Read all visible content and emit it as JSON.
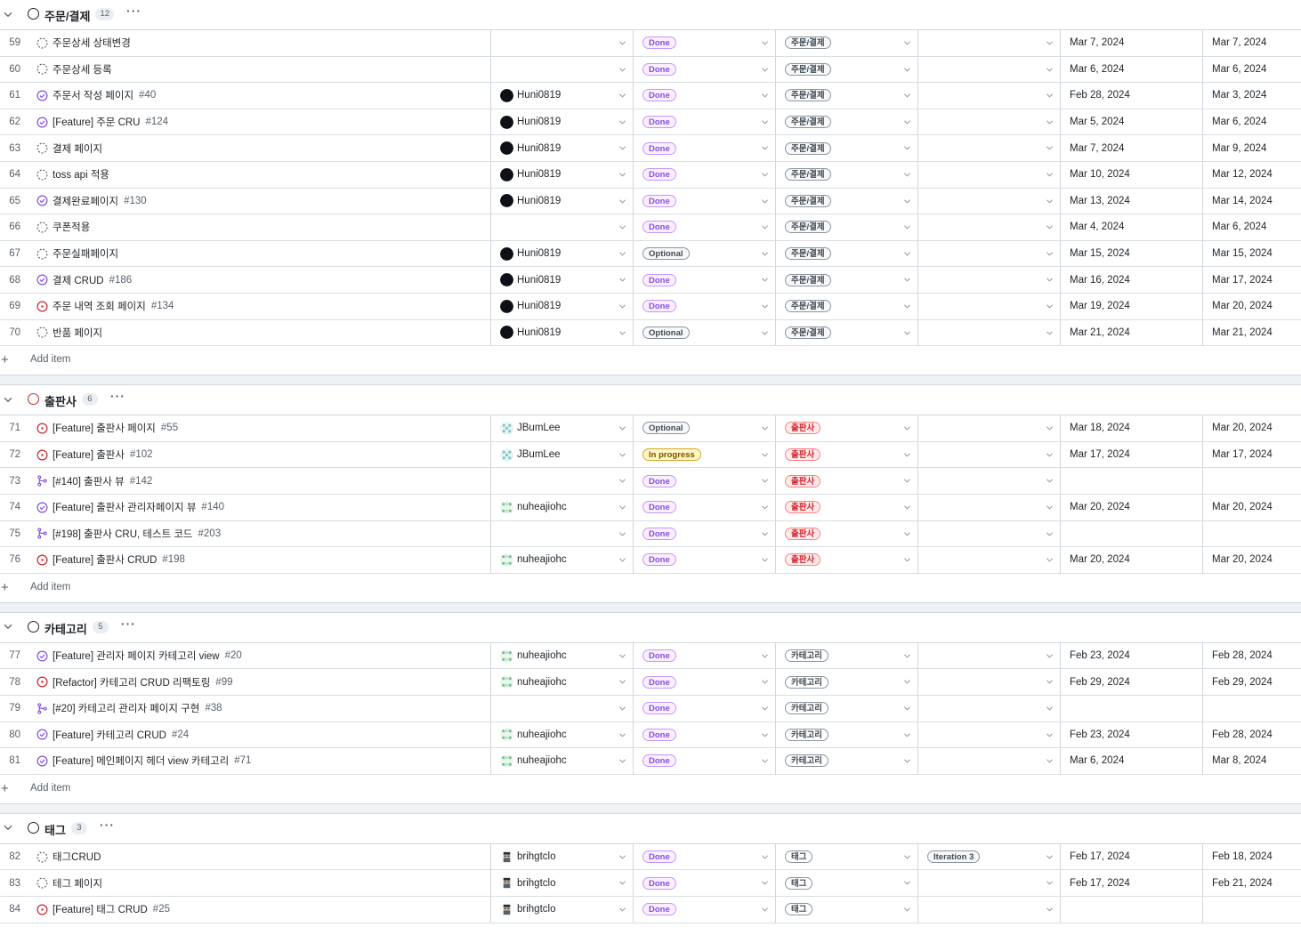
{
  "groups": [
    {
      "title": "주문/결제",
      "count": "12",
      "circle_color": "#1f2328",
      "rows": [
        {
          "num": "59",
          "icon": "draft-issue",
          "title": "주문상세 상태변경",
          "ref": "",
          "assignee": "",
          "avatar": "",
          "status": "Done",
          "label": "주문/결제",
          "iteration": "",
          "start": "Mar 7, 2024",
          "end": "Mar 7, 2024"
        },
        {
          "num": "60",
          "icon": "draft-issue",
          "title": "주문상세 등록",
          "ref": "",
          "assignee": "",
          "avatar": "",
          "status": "Done",
          "label": "주문/결제",
          "iteration": "",
          "start": "Mar 6, 2024",
          "end": "Mar 6, 2024"
        },
        {
          "num": "61",
          "icon": "closed-issue",
          "title": "주문서 작성 페이지",
          "ref": "#40",
          "assignee": "Huni0819",
          "avatar": "black",
          "status": "Done",
          "label": "주문/결제",
          "iteration": "",
          "start": "Feb 28, 2024",
          "end": "Mar 3, 2024"
        },
        {
          "num": "62",
          "icon": "closed-issue",
          "title": "[Feature] 주문 CRU",
          "ref": "#124",
          "assignee": "Huni0819",
          "avatar": "black",
          "status": "Done",
          "label": "주문/결제",
          "iteration": "",
          "start": "Mar 5, 2024",
          "end": "Mar 6, 2024"
        },
        {
          "num": "63",
          "icon": "draft-issue",
          "title": "결제 페이지",
          "ref": "",
          "assignee": "Huni0819",
          "avatar": "black",
          "status": "Done",
          "label": "주문/결제",
          "iteration": "",
          "start": "Mar 7, 2024",
          "end": "Mar 9, 2024"
        },
        {
          "num": "64",
          "icon": "draft-issue",
          "title": "toss api 적용",
          "ref": "",
          "assignee": "Huni0819",
          "avatar": "black",
          "status": "Done",
          "label": "주문/결제",
          "iteration": "",
          "start": "Mar 10, 2024",
          "end": "Mar 12, 2024"
        },
        {
          "num": "65",
          "icon": "closed-issue",
          "title": "결제완료페이지",
          "ref": "#130",
          "assignee": "Huni0819",
          "avatar": "black",
          "status": "Done",
          "label": "주문/결제",
          "iteration": "",
          "start": "Mar 13, 2024",
          "end": "Mar 14, 2024"
        },
        {
          "num": "66",
          "icon": "draft-issue",
          "title": "쿠폰적용",
          "ref": "",
          "assignee": "",
          "avatar": "",
          "status": "Done",
          "label": "주문/결제",
          "iteration": "",
          "start": "Mar 4, 2024",
          "end": "Mar 6, 2024"
        },
        {
          "num": "67",
          "icon": "draft-issue",
          "title": "주문실패페이지",
          "ref": "",
          "assignee": "Huni0819",
          "avatar": "black",
          "status": "Optional",
          "label": "주문/결제",
          "iteration": "",
          "start": "Mar 15, 2024",
          "end": "Mar 15, 2024"
        },
        {
          "num": "68",
          "icon": "closed-issue",
          "title": "결제 CRUD",
          "ref": "#186",
          "assignee": "Huni0819",
          "avatar": "black",
          "status": "Done",
          "label": "주문/결제",
          "iteration": "",
          "start": "Mar 16, 2024",
          "end": "Mar 17, 2024"
        },
        {
          "num": "69",
          "icon": "open-issue",
          "title": "주문 내역 조회 페이지",
          "ref": "#134",
          "assignee": "Huni0819",
          "avatar": "black",
          "status": "Done",
          "label": "주문/결제",
          "iteration": "",
          "start": "Mar 19, 2024",
          "end": "Mar 20, 2024"
        },
        {
          "num": "70",
          "icon": "draft-issue",
          "title": "반품 페이지",
          "ref": "",
          "assignee": "Huni0819",
          "avatar": "black",
          "status": "Optional",
          "label": "주문/결제",
          "iteration": "",
          "start": "Mar 21, 2024",
          "end": "Mar 21, 2024"
        }
      ],
      "add_label": "Add item"
    },
    {
      "title": "출판사",
      "count": "6",
      "circle_color": "#cf222e",
      "rows": [
        {
          "num": "71",
          "icon": "open-issue",
          "title": "[Feature] 출판사 페이지",
          "ref": "#55",
          "assignee": "JBumLee",
          "avatar": "teal",
          "status": "Optional",
          "label": "출판사",
          "iteration": "",
          "start": "Mar 18, 2024",
          "end": "Mar 20, 2024"
        },
        {
          "num": "72",
          "icon": "open-issue",
          "title": "[Feature] 출판사",
          "ref": "#102",
          "assignee": "JBumLee",
          "avatar": "teal",
          "status": "In progress",
          "label": "출판사",
          "iteration": "",
          "start": "Mar 17, 2024",
          "end": "Mar 17, 2024"
        },
        {
          "num": "73",
          "icon": "merged-pr",
          "title": "[#140] 출판사 뷰",
          "ref": "#142",
          "assignee": "",
          "avatar": "",
          "status": "Done",
          "label": "출판사",
          "iteration": "",
          "start": "",
          "end": ""
        },
        {
          "num": "74",
          "icon": "closed-issue",
          "title": "[Feature] 출판사 관리자페이지 뷰",
          "ref": "#140",
          "assignee": "nuheajiohc",
          "avatar": "green",
          "status": "Done",
          "label": "출판사",
          "iteration": "",
          "start": "Mar 20, 2024",
          "end": "Mar 20, 2024"
        },
        {
          "num": "75",
          "icon": "merged-pr",
          "title": "[#198] 출판사 CRU, 테스트 코드",
          "ref": "#203",
          "assignee": "",
          "avatar": "",
          "status": "Done",
          "label": "출판사",
          "iteration": "",
          "start": "",
          "end": ""
        },
        {
          "num": "76",
          "icon": "open-issue",
          "title": "[Feature] 출판사 CRUD",
          "ref": "#198",
          "assignee": "nuheajiohc",
          "avatar": "green",
          "status": "Done",
          "label": "출판사",
          "iteration": "",
          "start": "Mar 20, 2024",
          "end": "Mar 20, 2024"
        }
      ],
      "add_label": "Add item"
    },
    {
      "title": "카테고리",
      "count": "5",
      "circle_color": "#1f2328",
      "rows": [
        {
          "num": "77",
          "icon": "closed-issue",
          "title": "[Feature] 관리자 페이지 카테고리 view",
          "ref": "#20",
          "assignee": "nuheajiohc",
          "avatar": "green",
          "status": "Done",
          "label": "카테고리",
          "iteration": "",
          "start": "Feb 23, 2024",
          "end": "Feb 28, 2024"
        },
        {
          "num": "78",
          "icon": "open-issue",
          "title": "[Refactor] 카테고리 CRUD 리팩토링",
          "ref": "#99",
          "assignee": "nuheajiohc",
          "avatar": "green",
          "status": "Done",
          "label": "카테고리",
          "iteration": "",
          "start": "Feb 29, 2024",
          "end": "Feb 29, 2024"
        },
        {
          "num": "79",
          "icon": "merged-pr",
          "title": "[#20] 카테고리 관리자 페이지 구현",
          "ref": "#38",
          "assignee": "",
          "avatar": "",
          "status": "Done",
          "label": "카테고리",
          "iteration": "",
          "start": "",
          "end": ""
        },
        {
          "num": "80",
          "icon": "closed-issue",
          "title": "[Feature] 카테고리 CRUD",
          "ref": "#24",
          "assignee": "nuheajiohc",
          "avatar": "green",
          "status": "Done",
          "label": "카테고리",
          "iteration": "",
          "start": "Feb 23, 2024",
          "end": "Feb 28, 2024"
        },
        {
          "num": "81",
          "icon": "closed-issue",
          "title": "[Feature] 메인페이지 헤더 view 카테고리",
          "ref": "#71",
          "assignee": "nuheajiohc",
          "avatar": "green",
          "status": "Done",
          "label": "카테고리",
          "iteration": "",
          "start": "Mar 6, 2024",
          "end": "Mar 8, 2024"
        }
      ],
      "add_label": "Add item"
    },
    {
      "title": "태그",
      "count": "3",
      "circle_color": "#1f2328",
      "rows": [
        {
          "num": "82",
          "icon": "draft-issue",
          "title": "태그CRUD",
          "ref": "",
          "assignee": "brihgtclo",
          "avatar": "pixel",
          "status": "Done",
          "label": "태그",
          "iteration": "Iteration 3",
          "start": "Feb 17, 2024",
          "end": "Feb 18, 2024"
        },
        {
          "num": "83",
          "icon": "draft-issue",
          "title": "테그 페이지",
          "ref": "",
          "assignee": "brihgtclo",
          "avatar": "pixel",
          "status": "Done",
          "label": "태그",
          "iteration": "",
          "start": "Feb 17, 2024",
          "end": "Feb 21, 2024"
        },
        {
          "num": "84",
          "icon": "open-issue",
          "title": "[Feature] 태그 CRUD",
          "ref": "#25",
          "assignee": "brihgtclo",
          "avatar": "pixel",
          "status": "Done",
          "label": "태그",
          "iteration": "",
          "start": "",
          "end": ""
        }
      ],
      "add_label": ""
    }
  ],
  "colors": {
    "done": "#8250df",
    "open": "#cf222e",
    "draft": "#57606a"
  }
}
